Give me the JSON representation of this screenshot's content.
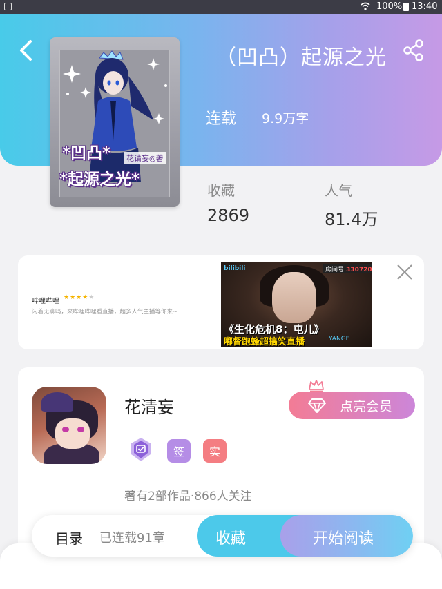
{
  "status_bar": {
    "battery": "100%",
    "time": "13:40"
  },
  "book": {
    "title": "（凹凸）起源之光",
    "status": "连载",
    "word_count": "9.9万字",
    "cover_text_line1": "*凹凸*",
    "cover_text_line2": "*起源之光*",
    "cover_author": "花请妄◎著"
  },
  "stats": {
    "favorites_label": "收藏",
    "favorites_value": "2869",
    "popularity_label": "人气",
    "popularity_value": "81.4万"
  },
  "ad": {
    "app_name": "哔哩哔哩",
    "rating": 4,
    "rating_max": 5,
    "description": "闲着无聊吗，来哔哩哔哩看直播，超多人气主播等你来~",
    "image_logo": "bilibili",
    "image_views": "房间号:",
    "image_views_num": "330720",
    "image_caption1": "《生化危机8：屯儿》",
    "image_caption2": "嘟督跑蜂超搞笑直播",
    "image_caption3": "YANGE"
  },
  "author": {
    "name": "花清妄",
    "vip_label": "点亮会员",
    "badge_sign": "签",
    "badge_real": "实",
    "meta": "著有2部作品·866人关注"
  },
  "bottom_bar": {
    "toc_label": "目录",
    "chapter_count": "已连载91章",
    "favorite_label": "收藏",
    "read_label": "开始阅读"
  }
}
